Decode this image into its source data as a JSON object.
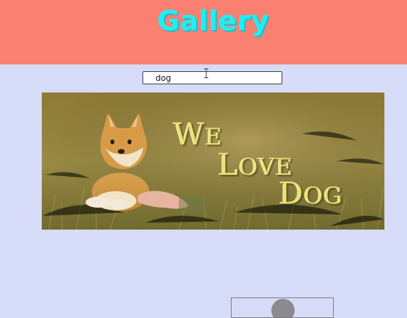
{
  "header": {
    "title": "Gallery",
    "background": "#fa8072",
    "title_color": "#22eef2"
  },
  "search": {
    "value": "dog"
  },
  "banner": {
    "line1_initial": "W",
    "line1_rest": "E",
    "line2_initial": "L",
    "line2_rest": "OVE",
    "line3_initial": "D",
    "line3_rest": "OG",
    "alt": "shiba-inu-photo"
  },
  "page": {
    "background": "#d6dcf7"
  }
}
